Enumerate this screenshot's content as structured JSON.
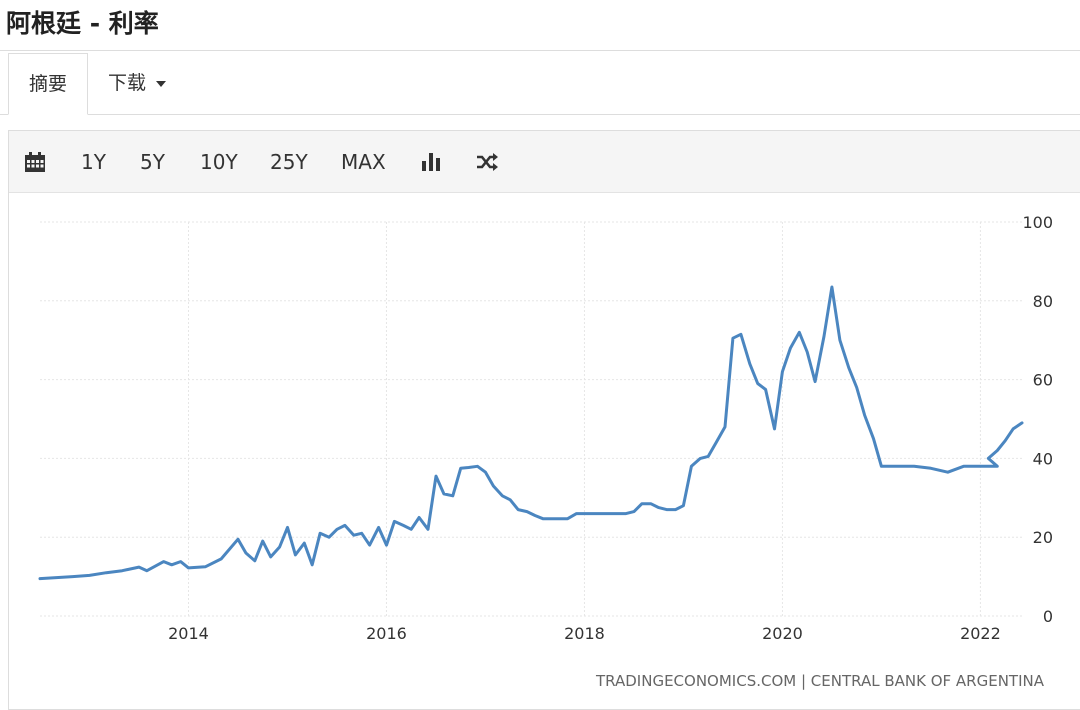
{
  "page": {
    "title": "阿根廷 - 利率"
  },
  "tabs": [
    {
      "label": "摘要",
      "active": true
    },
    {
      "label": "下载",
      "has_dropdown": true
    }
  ],
  "toolbar": {
    "icons": {
      "calendar": "calendar-icon",
      "chart_type": "bar-chart-icon",
      "compare": "shuffle-icon"
    },
    "ranges": [
      "1Y",
      "5Y",
      "10Y",
      "25Y",
      "MAX"
    ]
  },
  "chart_data": {
    "type": "line",
    "title": "",
    "xlabel": "",
    "ylabel": "",
    "x_ticks": [
      2014,
      2016,
      2018,
      2020,
      2022
    ],
    "y_ticks": [
      0,
      20,
      40,
      60,
      80,
      100
    ],
    "xlim": [
      2012.5,
      2022.42
    ],
    "ylim": [
      0,
      100
    ],
    "grid": true,
    "y_axis_side": "right",
    "line_color": "#4b86c0",
    "source": "TRADINGECONOMICS.COM | CENTRAL BANK OF ARGENTINA",
    "series": [
      {
        "name": "",
        "points": [
          [
            2012.5,
            9.5
          ],
          [
            2012.83,
            10.0
          ],
          [
            2013.0,
            10.3
          ],
          [
            2013.17,
            11.0
          ],
          [
            2013.33,
            11.5
          ],
          [
            2013.5,
            12.4
          ],
          [
            2013.58,
            11.5
          ],
          [
            2013.75,
            13.8
          ],
          [
            2013.83,
            13.0
          ],
          [
            2013.92,
            13.8
          ],
          [
            2014.0,
            12.2
          ],
          [
            2014.17,
            12.5
          ],
          [
            2014.33,
            14.5
          ],
          [
            2014.5,
            19.5
          ],
          [
            2014.58,
            16.0
          ],
          [
            2014.67,
            14.0
          ],
          [
            2014.75,
            19.0
          ],
          [
            2014.83,
            15.0
          ],
          [
            2014.92,
            17.5
          ],
          [
            2015.0,
            22.5
          ],
          [
            2015.08,
            15.5
          ],
          [
            2015.17,
            18.5
          ],
          [
            2015.25,
            13.0
          ],
          [
            2015.33,
            21.0
          ],
          [
            2015.42,
            20.0
          ],
          [
            2015.5,
            22.0
          ],
          [
            2015.58,
            23.0
          ],
          [
            2015.67,
            20.5
          ],
          [
            2015.75,
            21.0
          ],
          [
            2015.83,
            18.0
          ],
          [
            2015.92,
            22.5
          ],
          [
            2016.0,
            18.0
          ],
          [
            2016.08,
            24.0
          ],
          [
            2016.17,
            23.0
          ],
          [
            2016.25,
            22.0
          ],
          [
            2016.33,
            25.0
          ],
          [
            2016.42,
            22.0
          ],
          [
            2016.5,
            35.5
          ],
          [
            2016.58,
            31.0
          ],
          [
            2016.67,
            30.5
          ],
          [
            2016.75,
            37.5
          ],
          [
            2016.83,
            37.7
          ],
          [
            2016.92,
            38.0
          ],
          [
            2017.0,
            36.5
          ],
          [
            2017.08,
            33.0
          ],
          [
            2017.17,
            30.5
          ],
          [
            2017.25,
            29.5
          ],
          [
            2017.33,
            27.0
          ],
          [
            2017.42,
            26.5
          ],
          [
            2017.5,
            25.5
          ],
          [
            2017.58,
            24.7
          ],
          [
            2017.67,
            24.7
          ],
          [
            2017.75,
            24.7
          ],
          [
            2017.83,
            24.7
          ],
          [
            2017.92,
            26.0
          ],
          [
            2018.0,
            26.0
          ],
          [
            2018.08,
            26.0
          ],
          [
            2018.17,
            26.0
          ],
          [
            2018.25,
            26.0
          ],
          [
            2018.33,
            26.0
          ],
          [
            2018.42,
            26.0
          ],
          [
            2018.5,
            26.5
          ],
          [
            2018.58,
            28.5
          ],
          [
            2018.67,
            28.5
          ],
          [
            2018.75,
            27.5
          ],
          [
            2018.83,
            27.0
          ],
          [
            2018.92,
            27.0
          ],
          [
            2019.0,
            28.0
          ],
          [
            2019.08,
            38.0
          ],
          [
            2019.17,
            40.0
          ],
          [
            2019.25,
            40.5
          ],
          [
            2019.33,
            44.0
          ],
          [
            2019.42,
            48.0
          ],
          [
            2019.5,
            70.5
          ],
          [
            2019.58,
            71.5
          ],
          [
            2019.67,
            64.0
          ],
          [
            2019.75,
            59.0
          ],
          [
            2019.83,
            57.5
          ],
          [
            2019.92,
            47.5
          ],
          [
            2020.0,
            62.0
          ],
          [
            2020.08,
            68.0
          ],
          [
            2020.17,
            72.0
          ],
          [
            2020.25,
            67.0
          ],
          [
            2020.33,
            59.5
          ],
          [
            2020.42,
            71.0
          ],
          [
            2020.5,
            83.5
          ],
          [
            2020.58,
            70.0
          ],
          [
            2020.67,
            63.0
          ],
          [
            2020.75,
            58.0
          ],
          [
            2020.83,
            51.0
          ],
          [
            2020.92,
            45.0
          ],
          [
            2021.0,
            38.0
          ],
          [
            2021.17,
            38.0
          ],
          [
            2021.33,
            38.0
          ],
          [
            2021.5,
            37.5
          ],
          [
            2021.67,
            36.5
          ],
          [
            2021.83,
            38.0
          ],
          [
            2022.0,
            38.0
          ],
          [
            2022.17,
            38.0
          ],
          [
            2022.08,
            40.0
          ],
          [
            2022.17,
            42.0
          ],
          [
            2022.25,
            44.5
          ],
          [
            2022.33,
            47.5
          ],
          [
            2022.42,
            49.0
          ]
        ]
      }
    ]
  }
}
